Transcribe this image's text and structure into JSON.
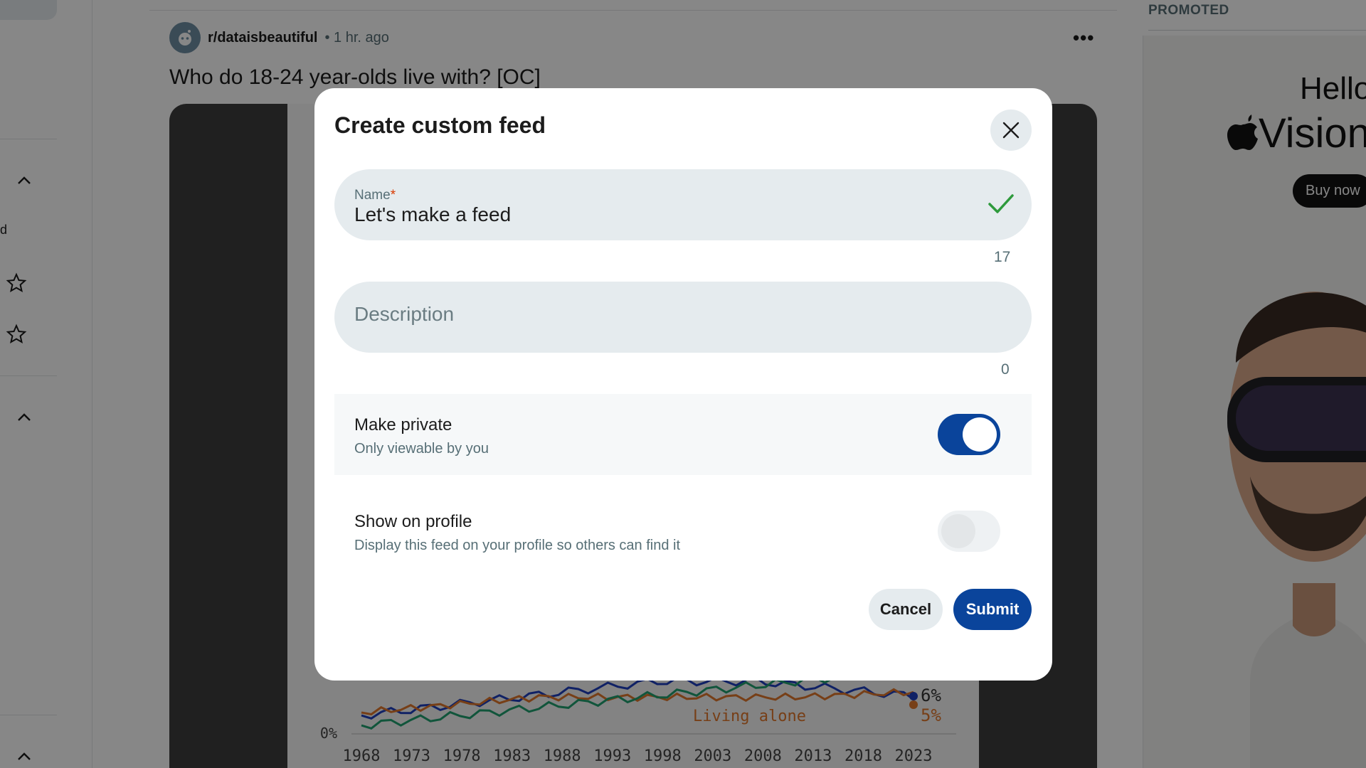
{
  "post": {
    "subreddit": "r/dataisbeautiful",
    "time": "• 1 hr. ago",
    "title": "Who do 18-24 year-olds live with? [OC]",
    "more_icon": "ellipsis-icon"
  },
  "left_nav": {
    "truncated_text": "d"
  },
  "chart_data": {
    "type": "line",
    "x_ticks": [
      "1968",
      "1973",
      "1978",
      "1983",
      "1988",
      "1993",
      "1998",
      "2003",
      "2008",
      "2013",
      "2018",
      "2023"
    ],
    "y_ticks": [
      "0%"
    ],
    "annotation": "Living alone",
    "end_labels": [
      "6%",
      "5%"
    ],
    "series_colors": [
      "#1f3fbf",
      "#e0772c",
      "#20a070"
    ]
  },
  "ad": {
    "label": "PROMOTED",
    "hello": "Hello",
    "product": "Vision",
    "buy": "Buy now"
  },
  "modal": {
    "title": "Create custom feed",
    "close_icon": "close-icon",
    "name_field": {
      "label": "Name",
      "required_mark": "*",
      "value": "Let's make a feed",
      "count": "17",
      "valid_icon": "check-icon"
    },
    "description_field": {
      "placeholder": "Description",
      "count": "0"
    },
    "make_private": {
      "title": "Make private",
      "subtitle": "Only viewable by you",
      "on": true
    },
    "show_on_profile": {
      "title": "Show on profile",
      "subtitle": "Display this feed on your profile so others can find it",
      "on": false
    },
    "cancel_label": "Cancel",
    "submit_label": "Submit"
  },
  "colors": {
    "accent": "#0a449b",
    "field_bg": "#e5ebee",
    "valid": "#2e9a3c"
  }
}
